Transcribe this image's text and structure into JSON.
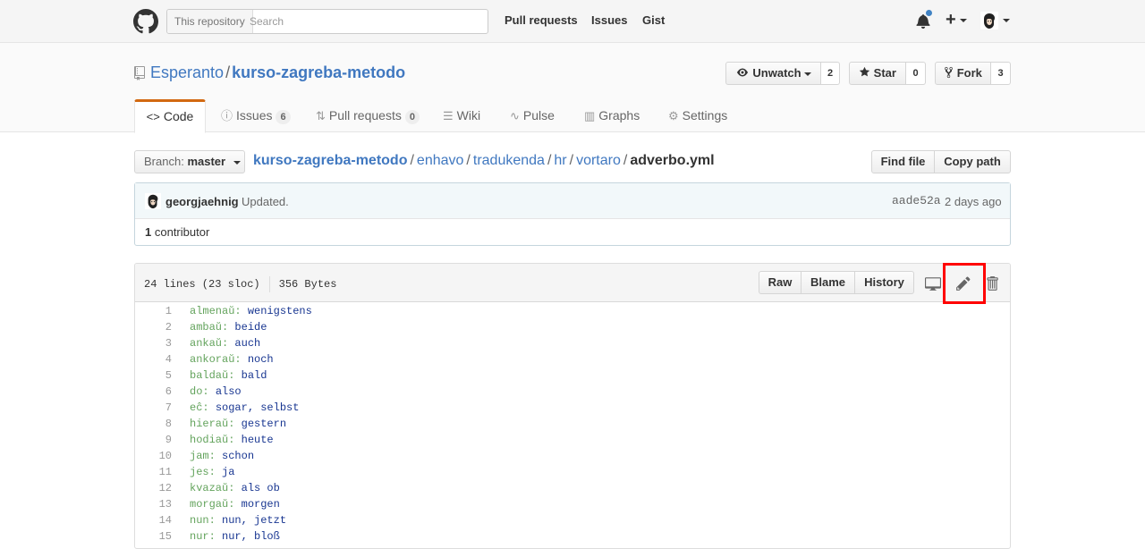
{
  "header": {
    "search_scope": "This repository",
    "search_placeholder": "Search",
    "nav": [
      "Pull requests",
      "Issues",
      "Gist"
    ],
    "plus": "+"
  },
  "repo": {
    "owner": "Esperanto",
    "separator": "/",
    "name": "kurso-zagreba-metodo",
    "unwatch_label": "Unwatch",
    "watch_count": "2",
    "star_label": "Star",
    "star_count": "0",
    "fork_label": "Fork",
    "fork_count": "3"
  },
  "tabs": {
    "code": "Code",
    "issues": "Issues",
    "issues_count": "6",
    "pull_requests": "Pull requests",
    "pull_requests_count": "0",
    "wiki": "Wiki",
    "pulse": "Pulse",
    "graphs": "Graphs",
    "settings": "Settings"
  },
  "breadcrumb": {
    "branch_prefix": "Branch:",
    "branch": "master",
    "path": [
      "kurso-zagreba-metodo",
      "enhavo",
      "tradukenda",
      "hr",
      "vortaro"
    ],
    "sep": "/",
    "file": "adverbo.yml",
    "find_file": "Find file",
    "copy_path": "Copy path"
  },
  "commit": {
    "author": "georgjaehnig",
    "message": "Updated.",
    "sha": "aade52a",
    "time": "2 days ago",
    "contributors_count": "1",
    "contributors_label": "contributor"
  },
  "file": {
    "lines_info": "24 lines (23 sloc)",
    "size": "356 Bytes",
    "raw": "Raw",
    "blame": "Blame",
    "history": "History",
    "lines": [
      {
        "n": "1",
        "key": "almenaŭ:",
        "val": "wenigstens"
      },
      {
        "n": "2",
        "key": "ambaŭ:",
        "val": "beide"
      },
      {
        "n": "3",
        "key": "ankaŭ:",
        "val": "auch"
      },
      {
        "n": "4",
        "key": "ankoraŭ:",
        "val": "noch"
      },
      {
        "n": "5",
        "key": "baldaŭ:",
        "val": "bald"
      },
      {
        "n": "6",
        "key": "do:",
        "val": "also"
      },
      {
        "n": "7",
        "key": "eĉ:",
        "val": "sogar, selbst"
      },
      {
        "n": "8",
        "key": "hieraŭ:",
        "val": "gestern"
      },
      {
        "n": "9",
        "key": "hodiaŭ:",
        "val": "heute"
      },
      {
        "n": "10",
        "key": "jam:",
        "val": "schon"
      },
      {
        "n": "11",
        "key": "jes:",
        "val": "ja"
      },
      {
        "n": "12",
        "key": "kvazaŭ:",
        "val": "als ob"
      },
      {
        "n": "13",
        "key": "morgaŭ:",
        "val": "morgen"
      },
      {
        "n": "14",
        "key": "nun:",
        "val": "nun, jetzt"
      },
      {
        "n": "15",
        "key": "nur:",
        "val": "nur, bloß"
      }
    ]
  },
  "colors": {
    "link": "#4078c0",
    "tab_accent": "#d26911",
    "yaml_key": "#63a35c",
    "yaml_value": "#183691",
    "highlight_box": "#ff0000"
  },
  "icons": [
    "github-logo-icon",
    "bell-icon",
    "plus-icon",
    "repo-icon",
    "eye-icon",
    "star-icon",
    "fork-icon",
    "code-icon",
    "issue-icon",
    "pull-request-icon",
    "wiki-icon",
    "pulse-icon",
    "graph-icon",
    "gear-icon",
    "desktop-icon",
    "pencil-icon",
    "trash-icon"
  ]
}
